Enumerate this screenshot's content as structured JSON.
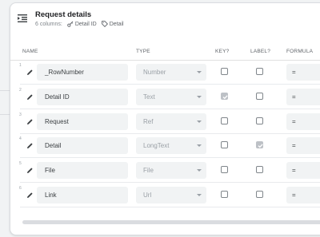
{
  "header": {
    "title": "Request details",
    "columns_count": "6 columns:",
    "key_chip": "Detail ID",
    "label_chip": "Detail"
  },
  "columns": {
    "name": "NAME",
    "type": "TYPE",
    "key": "KEY?",
    "label": "LABEL?",
    "formula": "FORMULA"
  },
  "rows": [
    {
      "num": "1",
      "name": "_RowNumber",
      "type": "Number",
      "key": false,
      "label": false,
      "formula": "="
    },
    {
      "num": "2",
      "name": "Detail ID",
      "type": "Text",
      "key": true,
      "label": false,
      "formula": "="
    },
    {
      "num": "3",
      "name": "Request",
      "type": "Ref",
      "key": false,
      "label": false,
      "formula": "="
    },
    {
      "num": "4",
      "name": "Detail",
      "type": "LongText",
      "key": false,
      "label": true,
      "formula": "="
    },
    {
      "num": "5",
      "name": "File",
      "type": "File",
      "key": false,
      "label": false,
      "formula": "="
    },
    {
      "num": "6",
      "name": "Link",
      "type": "Url",
      "key": false,
      "label": false,
      "formula": "="
    }
  ],
  "icons": {
    "header": "collapse-list-icon",
    "key_chip": "key-icon",
    "label_chip": "label-tag-icon",
    "row_edit": "pencil-icon"
  },
  "colors": {
    "card_bg": "#ffffff",
    "input_bg": "#f1f3f4",
    "checked_bg": "#bdc1c6"
  }
}
